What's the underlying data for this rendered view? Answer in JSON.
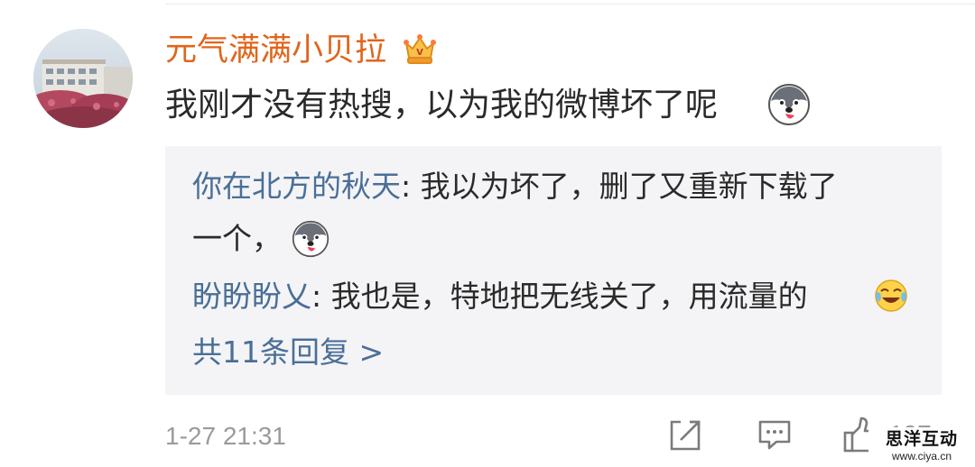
{
  "comment": {
    "username": "元气满满小贝拉",
    "text": "我刚才没有热搜，以为我的微博坏了呢",
    "timestamp": "1-27 21:31"
  },
  "replies": [
    {
      "user": "你在北方的秋天",
      "separator": ": ",
      "text_line1": "我以为坏了，删了又重新下载了",
      "text_line2": "一个，"
    },
    {
      "user": "盼盼盼乂",
      "separator": ": ",
      "text": "我也是，特地把无线关了，用流量的"
    }
  ],
  "more_replies": "共11条回复 >",
  "actions": {
    "like_count": "197"
  },
  "watermark": {
    "title": "思洋互动",
    "url": "www.ciya.cn"
  },
  "colors": {
    "username": "#e0651c",
    "reply_user": "#4a6f97",
    "reply_bg": "#f4f4f6",
    "meta_gray": "#9a9a9a"
  },
  "icons": [
    "avatar-photo",
    "crown-icon",
    "husky-emoji-icon",
    "laugh-cry-emoji-icon",
    "share-icon",
    "comment-icon",
    "like-icon"
  ]
}
